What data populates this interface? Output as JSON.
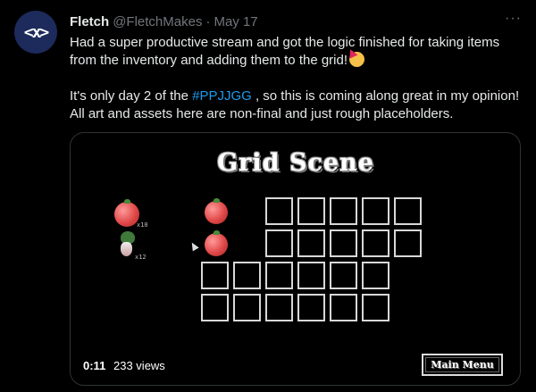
{
  "tweet": {
    "author_name": "Fletch",
    "handle": "@FletchMakes",
    "separator": "·",
    "date": "May 17",
    "more": "···",
    "paragraph1": "Had a super productive stream and got the logic finished for taking items from the inventory and adding them to the grid!",
    "paragraph2_before": "It's only day 2 of the ",
    "hashtag": "#PPJJGG",
    "paragraph2_after": " , so this is coming along great in my opinion! All art and assets here are non-final and just rough placeholders.",
    "emoji_name": "partying-face-icon"
  },
  "video": {
    "scene_title": "Grid Scene",
    "inventory": [
      {
        "item": "tomato",
        "count": "x10"
      },
      {
        "item": "radish",
        "count": "x12"
      }
    ],
    "grid_rows": 4,
    "grid_cols": 6,
    "row_items": [
      "tomato",
      "tomato"
    ],
    "menu_button": "Main Menu",
    "time": "0:11",
    "views": "233 views"
  }
}
